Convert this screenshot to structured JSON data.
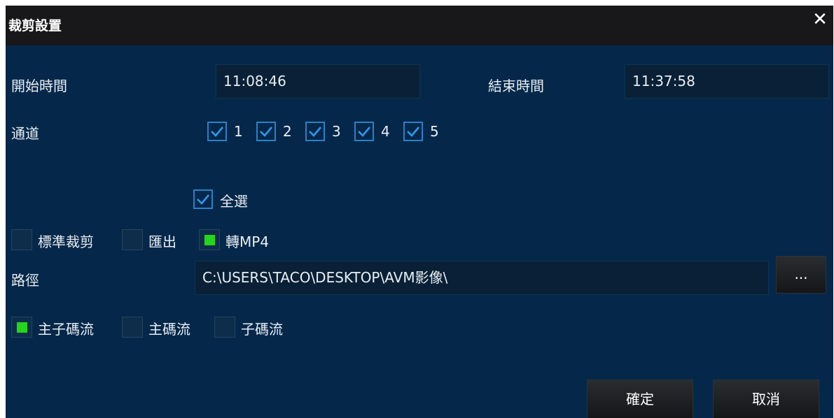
{
  "dialog": {
    "title": "裁剪設置",
    "close_icon": "close-icon"
  },
  "time": {
    "start_label": "開始時間",
    "start_value": "11:08:46",
    "end_label": "結束時間",
    "end_value": "11:37:58"
  },
  "channels": {
    "label": "通道",
    "items": [
      {
        "label": "1",
        "checked": true
      },
      {
        "label": "2",
        "checked": true
      },
      {
        "label": "3",
        "checked": true
      },
      {
        "label": "4",
        "checked": true
      },
      {
        "label": "5",
        "checked": true
      }
    ],
    "select_all": {
      "label": "全選",
      "checked": true
    }
  },
  "mode": {
    "items": [
      {
        "label": "標準裁剪",
        "checked": false
      },
      {
        "label": "匯出",
        "checked": false
      },
      {
        "label": "轉MP4",
        "checked": true
      }
    ]
  },
  "path": {
    "label": "路徑",
    "value": "C:\\USERS\\TACO\\DESKTOP\\AVM影像\\",
    "browse_label": "..."
  },
  "stream": {
    "items": [
      {
        "label": "主子碼流",
        "checked": true
      },
      {
        "label": "主碼流",
        "checked": false
      },
      {
        "label": "子碼流",
        "checked": false
      }
    ]
  },
  "actions": {
    "ok_label": "確定",
    "cancel_label": "取消"
  },
  "colors": {
    "panel_bg": "#05284a",
    "titlebar_bg": "#18181a",
    "checkbox_border": "#2b81c7",
    "radio_on": "#24d51a"
  }
}
